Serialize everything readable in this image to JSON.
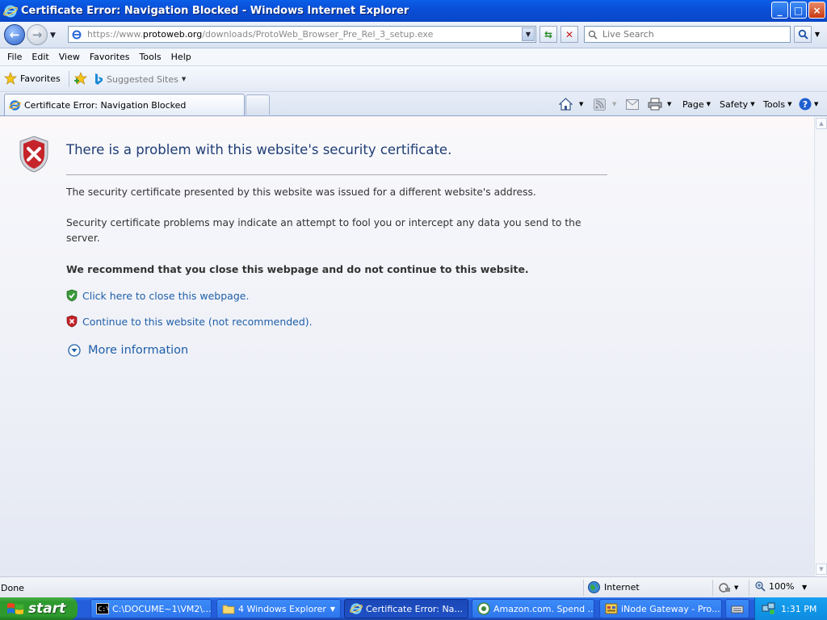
{
  "window": {
    "title": "Certificate Error: Navigation Blocked - Windows Internet Explorer",
    "controls": {
      "minimize": "_",
      "maximize": "□",
      "close": "×"
    }
  },
  "address_bar": {
    "url_prefix": "https://www.",
    "url_domain": "protoweb.org",
    "url_path": "/downloads/ProtoWeb_Browser_Pre_Rel_3_setup.exe",
    "search_placeholder": "Live Search"
  },
  "menu": {
    "items": [
      "File",
      "Edit",
      "View",
      "Favorites",
      "Tools",
      "Help"
    ]
  },
  "favorites_bar": {
    "favorites_label": "Favorites",
    "suggested_sites_label": "Suggested Sites"
  },
  "tabs": [
    {
      "label": "Certificate Error: Navigation Blocked"
    }
  ],
  "command_bar": {
    "page_label": "Page",
    "safety_label": "Safety",
    "tools_label": "Tools"
  },
  "page": {
    "heading": "There is a problem with this website's security certificate.",
    "paragraph1": "The security certificate presented by this website was issued for a different website's address.",
    "paragraph2": "Security certificate problems may indicate an attempt to fool you or intercept any data you send to the server.",
    "recommendation": "We recommend that you close this webpage and do not continue to this website.",
    "close_link": "Click here to close this webpage.",
    "continue_link": "Continue to this website (not recommended).",
    "more_info": "More information"
  },
  "status_bar": {
    "status_text": "Done",
    "zone_label": "Internet",
    "zoom_level": "100%"
  },
  "taskbar": {
    "start_label": "start",
    "tasks": [
      {
        "label": "C:\\DOCUME~1\\VM2\\..."
      },
      {
        "label": "4 Windows Explorer"
      },
      {
        "label": "Certificate Error: Na..."
      },
      {
        "label": "Amazon.com. Spend ..."
      },
      {
        "label": "iNode Gateway - Pro..."
      }
    ],
    "clock": "1:31 PM"
  },
  "colors": {
    "titlebar_blue": "#0a4fd8",
    "link_blue": "#1f5fa8",
    "heading_blue": "#1f3d74",
    "shield_red": "#c4242a",
    "shield_green": "#3a9a3a",
    "start_green": "#2e9a2e"
  },
  "icons": {
    "ie_logo": "ie-logo-icon",
    "error_shield": "error-shield-icon",
    "ok_shield": "ok-shield-icon",
    "more_info": "chevron-down-circle-icon"
  }
}
